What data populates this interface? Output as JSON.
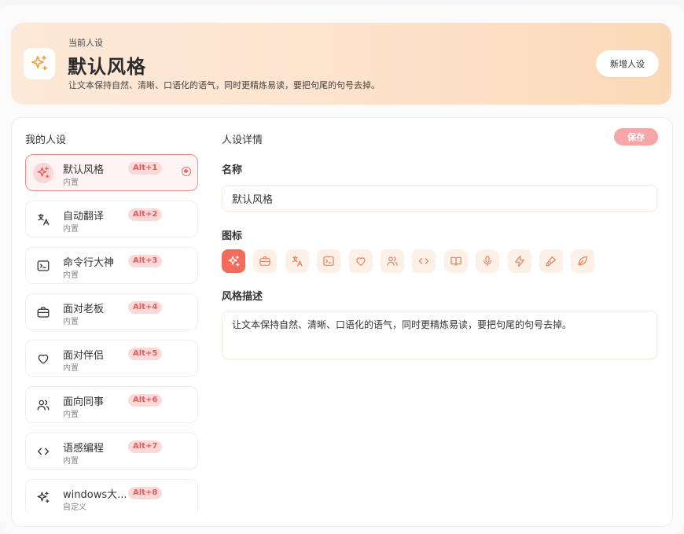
{
  "header": {
    "kicker": "当前人设",
    "title": "默认风格",
    "description": "让文本保持自然、清晰、口语化的语气，同时更精炼易读，要把句尾的句号去掉。",
    "new_button": "新增人设",
    "icon": "sparkles-icon",
    "accent": "#f0a33a"
  },
  "list": {
    "title": "我的人设",
    "items": [
      {
        "name": "默认风格",
        "tag": "内置",
        "shortcut": "Alt+1",
        "icon": "sparkles-icon",
        "active": true
      },
      {
        "name": "自动翻译",
        "tag": "内置",
        "shortcut": "Alt+2",
        "icon": "translate-icon"
      },
      {
        "name": "命令行大神",
        "tag": "内置",
        "shortcut": "Alt+3",
        "icon": "terminal-icon"
      },
      {
        "name": "面对老板",
        "tag": "内置",
        "shortcut": "Alt+4",
        "icon": "briefcase-icon"
      },
      {
        "name": "面对伴侣",
        "tag": "内置",
        "shortcut": "Alt+5",
        "icon": "heart-icon"
      },
      {
        "name": "面向同事",
        "tag": "内置",
        "shortcut": "Alt+6",
        "icon": "users-icon"
      },
      {
        "name": "语感编程",
        "tag": "内置",
        "shortcut": "Alt+7",
        "icon": "code-icon"
      },
      {
        "name": "windows大...",
        "tag": "自定义",
        "shortcut": "Alt+8",
        "icon": "sparkles-icon"
      }
    ]
  },
  "detail": {
    "title": "人设详情",
    "save_button": "保存",
    "name_label": "名称",
    "name_value": "默认风格",
    "icon_label": "图标",
    "icons": [
      "sparkles-icon",
      "briefcase-icon",
      "translate-icon",
      "terminal-icon",
      "heart-icon",
      "users-icon",
      "code-icon",
      "book-icon",
      "mic-icon",
      "zap-icon",
      "brush-icon",
      "leaf-icon"
    ],
    "selected_icon": "sparkles-icon",
    "desc_label": "风格描述",
    "desc_value": "让文本保持自然、清晰、口语化的语气，同时更精炼易读，要把句尾的句号去掉。"
  },
  "colors": {
    "accent_red": "#f26b5b",
    "badge_bg": "#fcd9d9",
    "badge_text": "#e25c5c",
    "save_bg": "#f6a6a6",
    "icon_tile_bg": "#fdf0e6"
  }
}
